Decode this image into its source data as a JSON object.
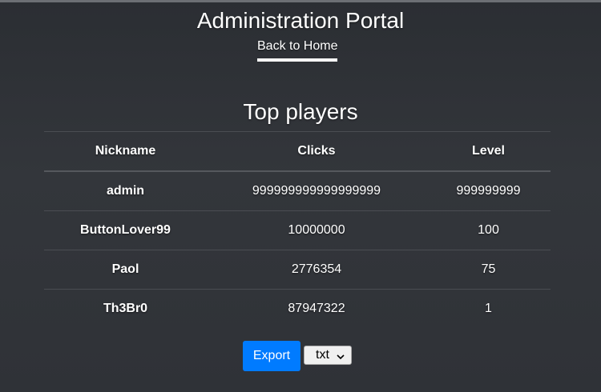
{
  "header": {
    "title": "Administration Portal",
    "back_link": "Back to Home"
  },
  "leaderboard": {
    "title": "Top players",
    "columns": [
      "Nickname",
      "Clicks",
      "Level"
    ],
    "rows": [
      {
        "nickname": "admin",
        "clicks": "999999999999999999",
        "level": "999999999"
      },
      {
        "nickname": "ButtonLover99",
        "clicks": "10000000",
        "level": "100"
      },
      {
        "nickname": "Paol",
        "clicks": "2776354",
        "level": "75"
      },
      {
        "nickname": "Th3Br0",
        "clicks": "87947322",
        "level": "1"
      }
    ]
  },
  "export": {
    "button_label": "Export",
    "format_selected": "txt",
    "format_icon": "chevron-down-icon"
  },
  "colors": {
    "accent": "#007bff",
    "background": "#2f3237"
  }
}
